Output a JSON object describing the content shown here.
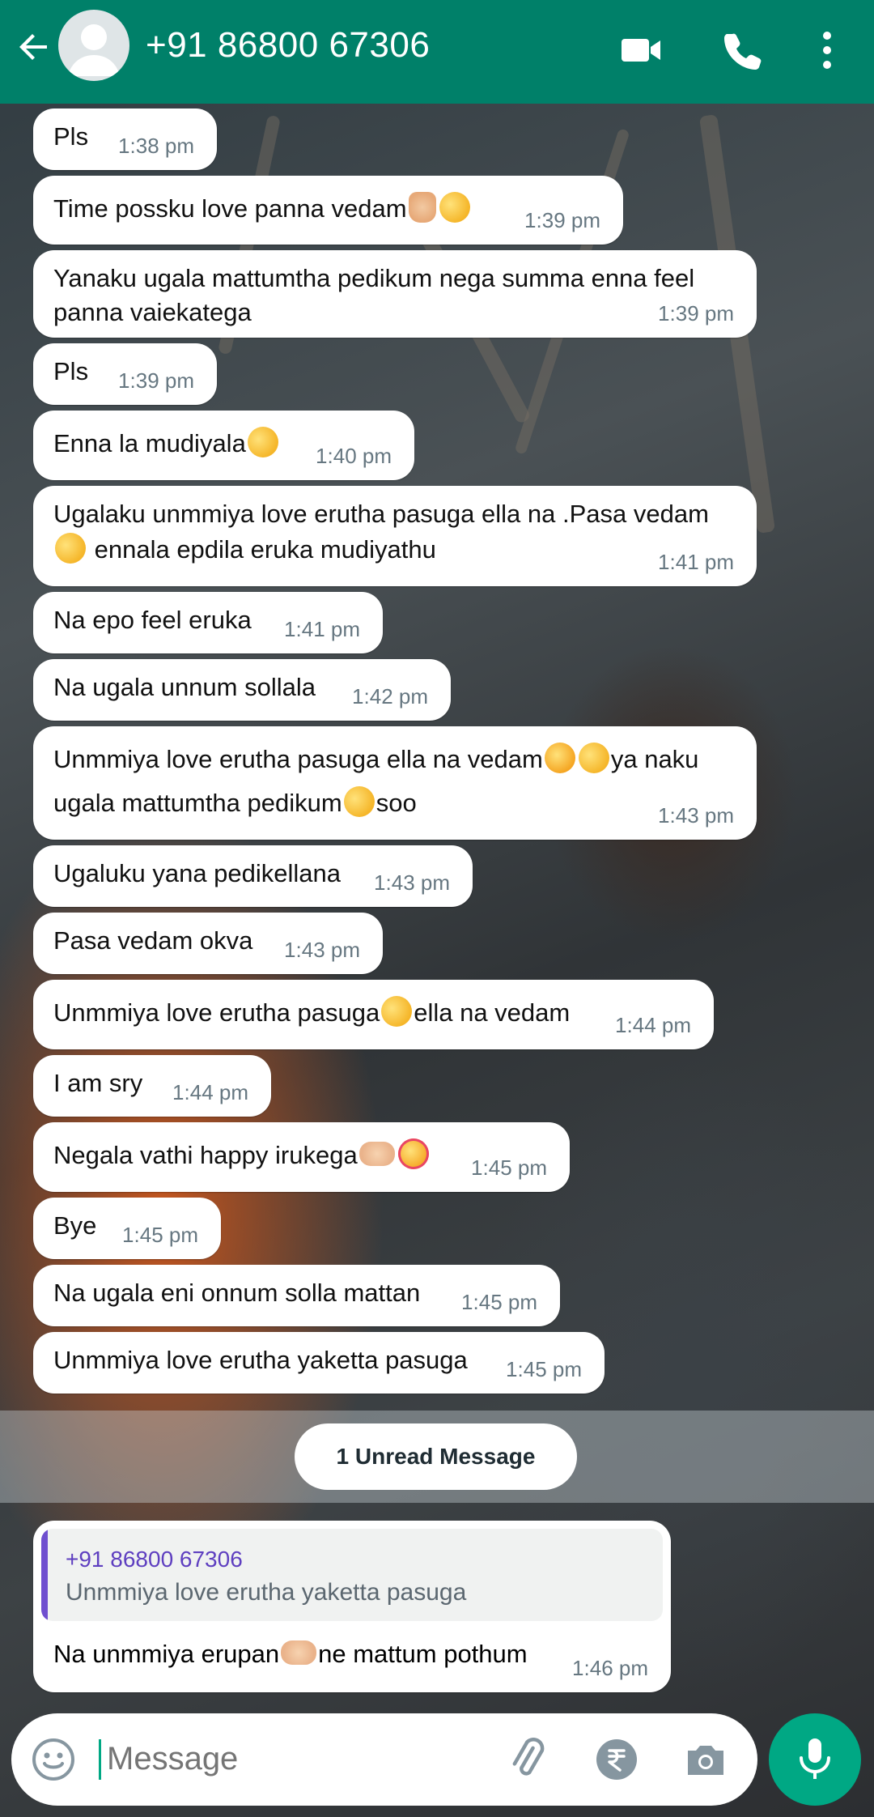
{
  "header": {
    "contact_name": "+91 86800 67306",
    "icons": [
      "back-arrow-icon",
      "avatar",
      "video-call-icon",
      "voice-call-icon",
      "more-options-icon"
    ]
  },
  "messages": [
    {
      "text": "Pls",
      "time": "1:38 pm"
    },
    {
      "text": "Time possku love panna vedam",
      "emoji": [
        "pray",
        "pensive"
      ],
      "time": "1:39 pm"
    },
    {
      "text": "Yanaku ugala mattumtha  pedikum nega summa enna feel panna vaiekatega",
      "time": "1:39 pm"
    },
    {
      "text": "Pls",
      "time": "1:39 pm"
    },
    {
      "text": "Enna la mudiyala",
      "emoji": [
        "pensive"
      ],
      "time": "1:40 pm"
    },
    {
      "text_line1": "Ugalaku unmmiya love erutha pasuga ella na .Pasa vedam",
      "text_line2": " ennala epdila eruka mudiyathu",
      "time": "1:41 pm"
    },
    {
      "text": "Na epo feel eruka",
      "time": "1:41 pm"
    },
    {
      "text": "Na ugala unnum sollala",
      "time": "1:42 pm"
    },
    {
      "text_a": "Unmmiya love erutha pasuga ella na vedam",
      "text_b": "ya naku",
      "text_c": "ugala mattumtha pedikum",
      "text_d": "soo",
      "time": "1:43 pm"
    },
    {
      "text": "Ugaluku yana pedikellana",
      "time": "1:43 pm"
    },
    {
      "text": "Pasa vedam okva",
      "time": "1:43 pm"
    },
    {
      "text_a": "Unmmiya love erutha pasuga",
      "text_b": "ella na vedam",
      "time": "1:44 pm"
    },
    {
      "text": "I am sry",
      "time": "1:44 pm"
    },
    {
      "text": "Negala vathi happy irukega",
      "time": "1:45 pm"
    },
    {
      "text": "Bye",
      "time": "1:45 pm"
    },
    {
      "text": "Na ugala eni onnum solla mattan",
      "time": "1:45 pm"
    },
    {
      "text": "Unmmiya love erutha yaketta pasuga",
      "time": "1:45 pm"
    }
  ],
  "unread_divider": "1 Unread Message",
  "reply": {
    "quoted_name": "+91 86800 67306",
    "quoted_text": "Unmmiya love erutha yaketta pasuga",
    "text_a": "Na unmmiya erupan",
    "text_b": "ne mattum pothum",
    "time": "1:46 pm"
  },
  "composer": {
    "placeholder": "Message",
    "icons": [
      "emoji-icon",
      "attach-icon",
      "rupee-payment-icon",
      "camera-icon",
      "mic-icon"
    ]
  },
  "colors": {
    "header": "#008069",
    "accent": "#00a884",
    "quote_bar": "#6f4fcf"
  }
}
